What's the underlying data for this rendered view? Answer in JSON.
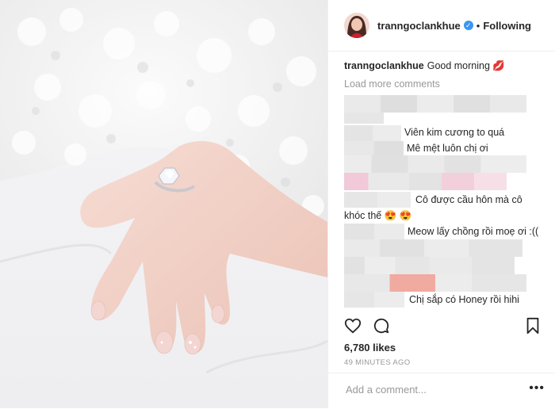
{
  "header": {
    "username": "tranngoclankhue",
    "verified_glyph": "✓",
    "separator": "•",
    "follow_status": "Following"
  },
  "caption": {
    "username": "tranngoclankhue",
    "text": "Good morning 💋"
  },
  "load_more": "Load more comments",
  "comments": [
    {
      "text": "Viên kim cương to quá"
    },
    {
      "text": "Mê mệt luôn chị ơi"
    },
    {
      "text": "Cô được cầu hôn mà cô"
    },
    {
      "text": "khóc thế 😍 😍"
    },
    {
      "text": "Meow lấy chồng rồi moẹ ơi :(("
    },
    {
      "text": "Chị sắp có Honey rồi hihi"
    }
  ],
  "actions": {
    "like_icon": "heart-icon",
    "comment_icon": "comment-icon",
    "save_icon": "bookmark-icon"
  },
  "likes": "6,780 likes",
  "time_ago": "49 MINUTES AGO",
  "add_comment": {
    "placeholder": "Add a comment...",
    "more_label": "•••"
  },
  "colors": {
    "blur_light": "#ececec",
    "blur_mid": "#e2e2e2",
    "blur_pink": "#f2c9d8",
    "blur_salmon": "#f0aaa0",
    "verified": "#3897f0"
  }
}
